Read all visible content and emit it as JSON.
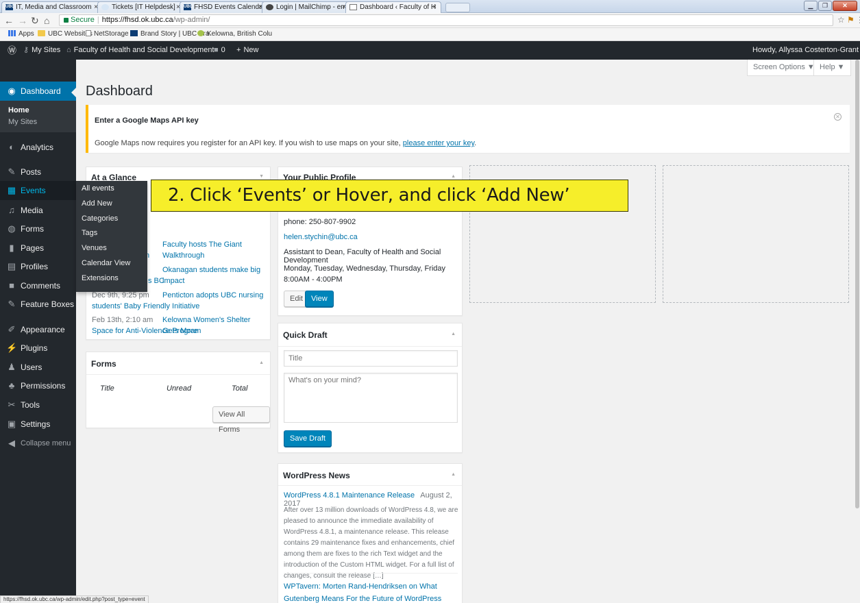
{
  "browser": {
    "tabs": [
      {
        "title": "IT, Media and Classroom",
        "icon": "ubc-icon"
      },
      {
        "title": "Tickets [IT Helpdesk]",
        "icon": "globe-icon"
      },
      {
        "title": "FHSD Events Calendar",
        "icon": "ubc-icon"
      },
      {
        "title": "Login | MailChimp - ema",
        "icon": "mailchimp-icon"
      },
      {
        "title": "Dashboard ‹ Faculty of H",
        "icon": "page-icon",
        "active": true
      }
    ],
    "tab_close": "×",
    "secure_label": "Secure",
    "url_host": "https://fhsd.ok.ubc.ca",
    "url_path": "/wp-admin/",
    "bookmarks": [
      "Apps",
      "UBC Websites",
      "NetStorage",
      "Brand Story | UBC Bra",
      "Kelowna, British Colu"
    ]
  },
  "adminbar": {
    "my_sites": "My Sites",
    "site_name": "Faculty of Health and Social Development",
    "comments_count": "0",
    "new_label": "New",
    "howdy": "Howdy, Allyssa Costerton-Grant"
  },
  "sidebar": {
    "dashboard": "Dashboard",
    "home": "Home",
    "my_sites": "My Sites",
    "items": [
      {
        "label": "Analytics",
        "icon": "analytics-icon"
      },
      {
        "label": "Posts",
        "icon": "pin-icon"
      },
      {
        "label": "Events",
        "icon": "calendar-icon"
      },
      {
        "label": "Media",
        "icon": "media-icon"
      },
      {
        "label": "Forms",
        "icon": "forms-icon"
      },
      {
        "label": "Pages",
        "icon": "pages-icon"
      },
      {
        "label": "Profiles",
        "icon": "profiles-icon"
      },
      {
        "label": "Comments",
        "icon": "comments-icon"
      },
      {
        "label": "Feature Boxes",
        "icon": "pin-icon"
      },
      {
        "label": "Appearance",
        "icon": "brush-icon"
      },
      {
        "label": "Plugins",
        "icon": "plug-icon"
      },
      {
        "label": "Users",
        "icon": "users-icon"
      },
      {
        "label": "Permissions",
        "icon": "permissions-icon"
      },
      {
        "label": "Tools",
        "icon": "wrench-icon"
      },
      {
        "label": "Settings",
        "icon": "settings-icon"
      }
    ],
    "collapse": "Collapse menu"
  },
  "events_flyout": [
    "All events",
    "Add New",
    "Categories",
    "Tags",
    "Venues",
    "Calendar View",
    "Extensions"
  ],
  "main": {
    "title": "Dashboard",
    "screen_options": "Screen Options ▼",
    "help": "Help ▼",
    "notice": {
      "title": "Enter a Google Maps API key",
      "text": "Google Maps now requires you register for an API key. If you wish to use maps on your site, ",
      "link": "please enter your key",
      "tail": "."
    },
    "at_a_glance": {
      "title": "At a Glance",
      "rows": [
        {
          "date": "",
          "link": "Faculty hosts The Giant Walkthrough",
          "cont": "n"
        },
        {
          "date": "",
          "link": "Okanagan students make big impact",
          "cont": "s BC"
        },
        {
          "date": "Dec 9th, 9:25 pm",
          "link": "Penticton adopts UBC nursing",
          "cont": "students' Baby Friendly Initiative"
        },
        {
          "date": "Feb 13th, 2:10 am",
          "link": "Kelowna Women's Shelter Gets More",
          "cont": "Space for Anti-Violence Program"
        }
      ]
    },
    "forms": {
      "title": "Forms",
      "col_title": "Title",
      "col_unread": "Unread",
      "col_total": "Total",
      "view_all": "View All Forms"
    },
    "profile": {
      "title": "Your Public Profile",
      "phone": "phone: 250-807-9902",
      "email": "helen.stychin@ubc.ca",
      "role": "Assistant to Dean, Faculty of Health and Social Development",
      "hours": "Monday, Tuesday, Wednesday, Thursday, Friday 8:00AM - 4:00PM",
      "edit": "Edit",
      "view": "View"
    },
    "quick_draft": {
      "title": "Quick Draft",
      "title_placeholder": "Title",
      "content_placeholder": "What's on your mind?",
      "save": "Save Draft"
    },
    "news": {
      "title": "WordPress News",
      "item1_title": "WordPress 4.8.1 Maintenance Release",
      "item1_date": "August 2, 2017",
      "item1_text": "After over 13 million downloads of WordPress 4.8, we are pleased to announce the immediate availability of WordPress 4.8.1, a maintenance release. This release contains 29 maintenance fixes and enhancements, chief among them are fixes to the rich Text widget and the introduction of the Custom HTML widget. For a full list of changes, consult the release […]",
      "item2_title": "WPTavern: Morten Rand-Hendriksen on What Gutenberg Means For the Future of WordPress"
    }
  },
  "callout": "2. Click ‘Events’ or Hover, and click ‘Add New’",
  "status_url": "https://fhsd.ok.ubc.ca/wp-admin/edit.php?post_type=event",
  "colors": {
    "accent": "#0073aa",
    "adminbar": "#23282d",
    "callout": "#f6ee2a",
    "notice_border": "#ffb900"
  }
}
